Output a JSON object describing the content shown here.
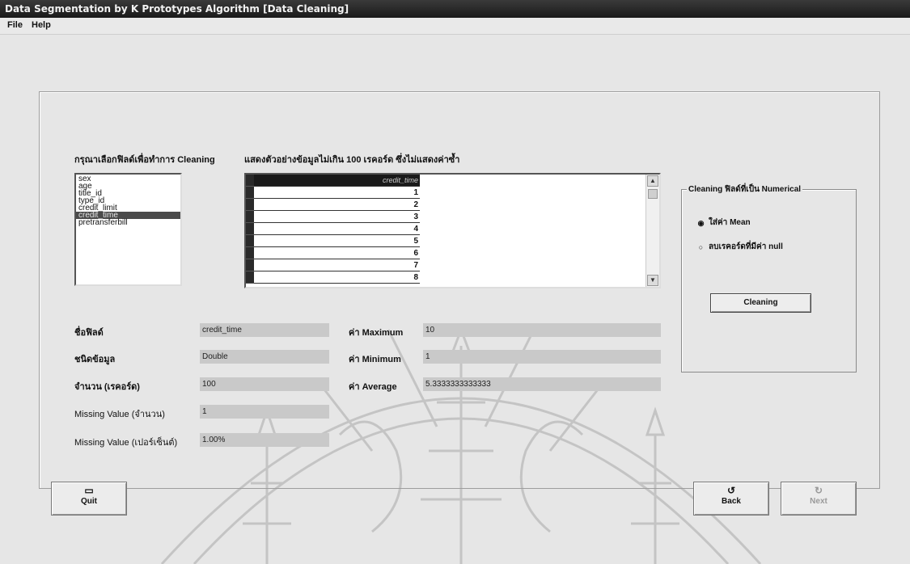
{
  "window": {
    "title": "Data Segmentation by K Prototypes Algorithm  [Data Cleaning]"
  },
  "menu": {
    "file": "File",
    "help": "Help"
  },
  "labels": {
    "select_field": "กรุณาเลือกฟิลด์เพื่อทำการ Cleaning",
    "sample_data": "แสดงตัวอย่างข้อมูลไม่เกิน 100 เรคอร์ด ซึ่งไม่แสดงค่าซ้ำ"
  },
  "field_list": {
    "items": [
      "sex",
      "age",
      "title_id",
      "type_id",
      "credit_limit",
      "credit_time",
      "pretransferbill"
    ],
    "selected": "credit_time"
  },
  "grid": {
    "header": "credit_time",
    "rows": [
      "1",
      "2",
      "3",
      "4",
      "5",
      "6",
      "7",
      "8"
    ]
  },
  "cleaning_group": {
    "title": "Cleaning ฟิลด์ที่เป็น Numerical",
    "option_mean": "ใส่ค่า Mean",
    "option_delete": "ลบเรคอร์ดที่มีค่า null",
    "button": "Cleaning",
    "selected_option": "mean"
  },
  "info": {
    "field_name_label": "ชื่อฟิลด์",
    "field_name_value": "credit_time",
    "data_type_label": "ชนิดข้อมูล",
    "data_type_value": "Double",
    "count_label": "จำนวน (เรคอร์ด)",
    "count_value": "100",
    "missing_count_label": "Missing Value (จำนวน)",
    "missing_count_value": "1",
    "missing_pct_label": "Missing Value (เปอร์เซ็นต์)",
    "missing_pct_value": "1.00%",
    "max_label": "ค่า Maximum",
    "max_value": "10",
    "min_label": "ค่า Minimum",
    "min_value": "1",
    "avg_label": "ค่า Average",
    "avg_value": "5.3333333333333"
  },
  "buttons": {
    "quit": "Quit",
    "back": "Back",
    "next": "Next"
  }
}
